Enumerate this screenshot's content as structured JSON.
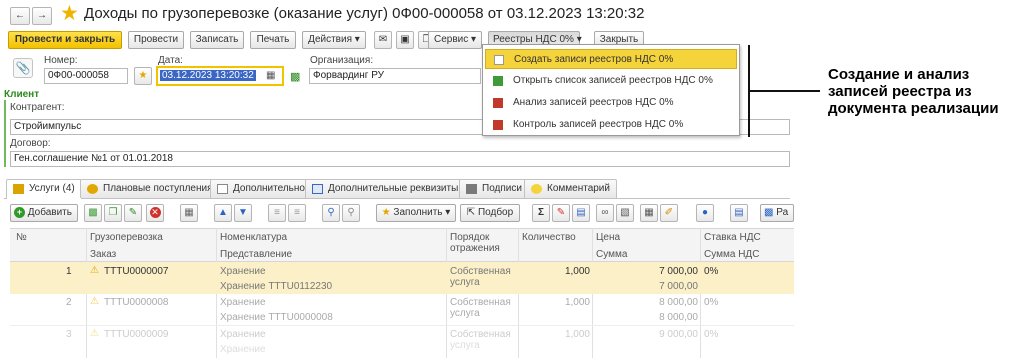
{
  "window": {
    "title": "Доходы по грузоперевозке (оказание услуг) 0Ф00-000058 от 03.12.2023 13:20:32"
  },
  "toolbar": {
    "post_close": "Провести и закрыть",
    "post": "Провести",
    "write": "Записать",
    "print": "Печать",
    "actions": "Действия",
    "service": "Сервис",
    "vat_registers": "Реестры НДС 0%",
    "close": "Закрыть"
  },
  "vat_menu": {
    "items": [
      "Создать записи реестров НДС 0%",
      "Открыть список записей реестров НДС 0%",
      "Анализ записей реестров НДС 0%",
      "Контроль записей реестров НДС 0%"
    ]
  },
  "form": {
    "number_label": "Номер:",
    "number_value": "0Ф00-000058",
    "date_label": "Дата:",
    "date_value": "03.12.2023 13:20:32",
    "org_label": "Организация:",
    "org_value": "Форвардинг РУ",
    "client_section": "Клиент",
    "counterparty_label": "Контрагент:",
    "counterparty_value": "Стройимпульс",
    "contract_label": "Договор:",
    "contract_value": "Ген.соглашение №1 от 01.01.2018"
  },
  "tabs": [
    "Услуги (4)",
    "Плановые поступления",
    "Дополнительно",
    "Дополнительные реквизиты",
    "Подписи",
    "Комментарий"
  ],
  "table_toolbar": {
    "add": "Добавить",
    "fill": "Заполнить",
    "select": "Подбор",
    "cut_label": "Ра"
  },
  "table": {
    "headers": {
      "num": "№",
      "cargo": "Грузоперевозка",
      "order": "Заказ",
      "nomenclature": "Номенклатура",
      "representation": "Представление",
      "reflection_1": "Порядок",
      "reflection_2": "отражения",
      "quantity": "Количество",
      "price": "Цена",
      "sum": "Сумма",
      "vat_rate": "Ставка НДС",
      "vat_sum": "Сумма НДС"
    },
    "rows": [
      {
        "num": "1",
        "cargo": "ТТТU0000007",
        "nomenclature": "Хранение",
        "representation": "Хранение ТТТU0112230",
        "reflection_1": "Собственная",
        "reflection_2": "услуга",
        "quantity": "1,000",
        "price": "7 000,00",
        "sum": "7 000,00",
        "vat_rate": "0%"
      },
      {
        "num": "2",
        "cargo": "ТТТU0000008",
        "nomenclature": "Хранение",
        "representation": "Хранение ТТТU0000008",
        "reflection_1": "Собственная",
        "reflection_2": "услуга",
        "quantity": "1,000",
        "price": "8 000,00",
        "sum": "8 000,00",
        "vat_rate": "0%"
      },
      {
        "num": "3",
        "cargo": "ТТТU0000009",
        "nomenclature": "Хранение",
        "representation": "Хранение",
        "reflection_1": "Собственная",
        "reflection_2": "услуга",
        "quantity": "1,000",
        "price": "9 000,00",
        "sum": "",
        "vat_rate": "0%"
      }
    ]
  },
  "callout": {
    "line1": "Создание и анализ",
    "line2": "записей реестра из",
    "line3": "документа реализации"
  },
  "colors": {
    "accent_yellow": "#f5d33b",
    "selected_row": "#fbf0c8",
    "client_green": "#2b8a1e",
    "star": "#f0b400"
  }
}
